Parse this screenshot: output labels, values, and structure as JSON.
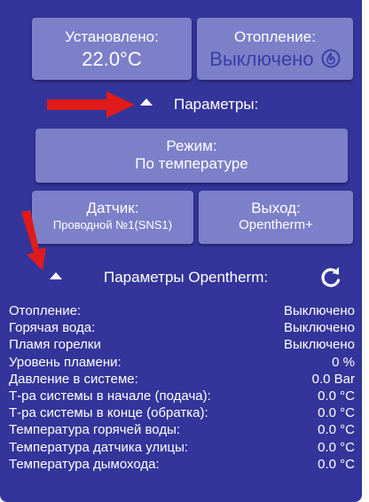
{
  "top": {
    "installed_label": "Установлено:",
    "installed_value": "22.0°C",
    "heating_label": "Отопление:",
    "heating_status": "Выключено"
  },
  "params": {
    "header": "Параметры:",
    "mode_label": "Режим:",
    "mode_value": "По температуре",
    "sensor_label": "Датчик:",
    "sensor_value": "Проводной №1(SNS1)",
    "output_label": "Выход:",
    "output_value": "Opentherm+"
  },
  "opentherm": {
    "header": "Параметры Opentherm:",
    "rows": [
      {
        "label": "Отопление:",
        "value": "Выключено"
      },
      {
        "label": "Горячая вода:",
        "value": "Выключено"
      },
      {
        "label": "Пламя горелки",
        "value": "Выключено"
      },
      {
        "label": "Уровень пламени:",
        "value": "0 %"
      },
      {
        "label": "Давление в системе:",
        "value": "0.0 Bar"
      },
      {
        "label": "Т-ра системы в начале (подача):",
        "value": "0.0 °C"
      },
      {
        "label": "Т-ра системы в конце (обратка):",
        "value": "0.0 °C"
      },
      {
        "label": "Температура горячей воды:",
        "value": "0.0 °C"
      },
      {
        "label": "Температура датчика улицы:",
        "value": "0.0 °C"
      },
      {
        "label": "Температура дымохода:",
        "value": "0.0 °C"
      }
    ]
  },
  "icons": {
    "heating": "flame-icon",
    "refresh": "refresh-icon",
    "collapse": "triangle-up-icon",
    "annotation": "red-arrow"
  },
  "colors": {
    "panel": "#33359a",
    "button": "#7c80c9",
    "status_text": "#3a3ea8",
    "annotation_arrow": "#e01b1b"
  }
}
